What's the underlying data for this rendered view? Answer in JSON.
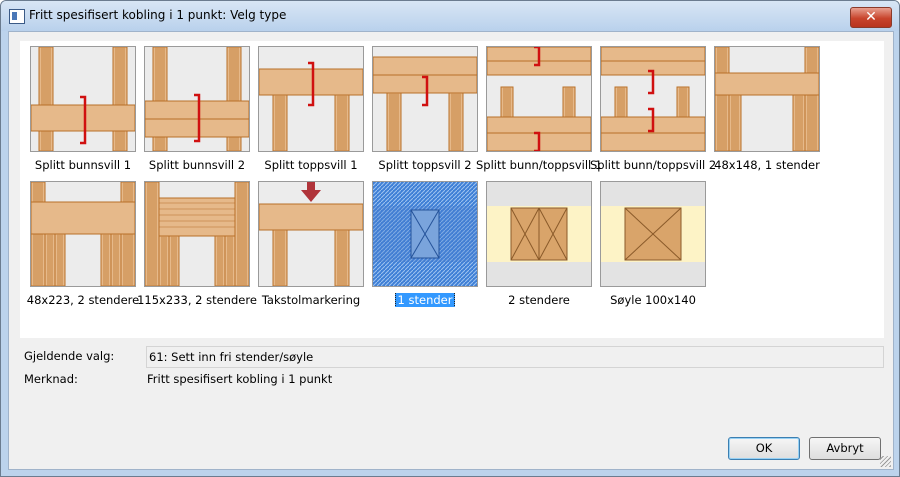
{
  "window": {
    "title": "Fritt spesifisert kobling i 1 punkt: Velg type",
    "close_label": "✕"
  },
  "gallery": {
    "items": [
      {
        "label": "Splitt bunnsvill 1",
        "icon": "split-bottom-plate-1-icon"
      },
      {
        "label": "Splitt bunnsvill 2",
        "icon": "split-bottom-plate-2-icon"
      },
      {
        "label": "Splitt toppsvill 1",
        "icon": "split-top-plate-1-icon"
      },
      {
        "label": "Splitt toppsvill 2",
        "icon": "split-top-plate-2-icon"
      },
      {
        "label": "Splitt bunn/toppsvill 1",
        "icon": "split-bottom-top-plate-1-icon"
      },
      {
        "label": "Splitt bunn/toppsvill 2",
        "icon": "split-bottom-top-plate-2-icon"
      },
      {
        "label": "48x148, 1 stender",
        "icon": "header-1-stud-icon"
      },
      {
        "label": "48x223, 2 stendere",
        "icon": "header-2-studs-icon"
      },
      {
        "label": "115x233, 2 stendere",
        "icon": "glulam-header-2-studs-icon"
      },
      {
        "label": "Takstolmarkering",
        "icon": "truss-marker-icon"
      },
      {
        "label": "1 stender",
        "icon": "single-stud-icon",
        "selected": true
      },
      {
        "label": "2 stendere",
        "icon": "double-stud-icon"
      },
      {
        "label": "Søyle 100x140",
        "icon": "column-icon"
      }
    ]
  },
  "current": {
    "label": "Gjeldende valg:",
    "value": "61: Sett inn fri stender/søyle"
  },
  "note": {
    "label": "Merknad:",
    "value": "Fritt spesifisert kobling i 1 punkt"
  },
  "buttons": {
    "ok": "OK",
    "cancel": "Avbryt"
  },
  "colors": {
    "selection": "#3399ff",
    "wood": "#e6b98a",
    "wood_dark": "#b86f28",
    "connector": "#d01010"
  }
}
